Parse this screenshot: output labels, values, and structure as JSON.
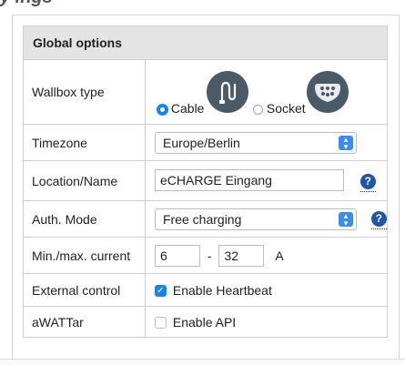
{
  "page_title_partial": "y   ings",
  "global_options": {
    "header": "Global options",
    "wallbox_type": {
      "label": "Wallbox type",
      "option_cable": "Cable",
      "option_socket": "Socket",
      "selected": "Cable"
    },
    "timezone": {
      "label": "Timezone",
      "value": "Europe/Berlin"
    },
    "location_name": {
      "label": "Location/Name",
      "value": "eCHARGE Eingang",
      "help_glyph": "?"
    },
    "auth_mode": {
      "label": "Auth. Mode",
      "value": "Free charging",
      "help_glyph": "?"
    },
    "current": {
      "label": "Min./max. current",
      "min": "6",
      "separator": "-",
      "max": "32",
      "unit": "A"
    },
    "external_control": {
      "label": "External control",
      "checkbox_label": "Enable Heartbeat",
      "checked": true
    },
    "awattar": {
      "label": "aWATTar",
      "checkbox_label": "Enable API",
      "checked": false
    }
  },
  "icons": {
    "select_arrow": "chevron-updown-icon",
    "help": "help-icon",
    "cable": "cable-plug-icon",
    "socket": "socket-plug-icon"
  },
  "colors": {
    "accent": "#1b84e7",
    "help_icon": "#1f56a8",
    "plug_icon": "#4a5a66",
    "header_bg": "#e4e4e4"
  }
}
